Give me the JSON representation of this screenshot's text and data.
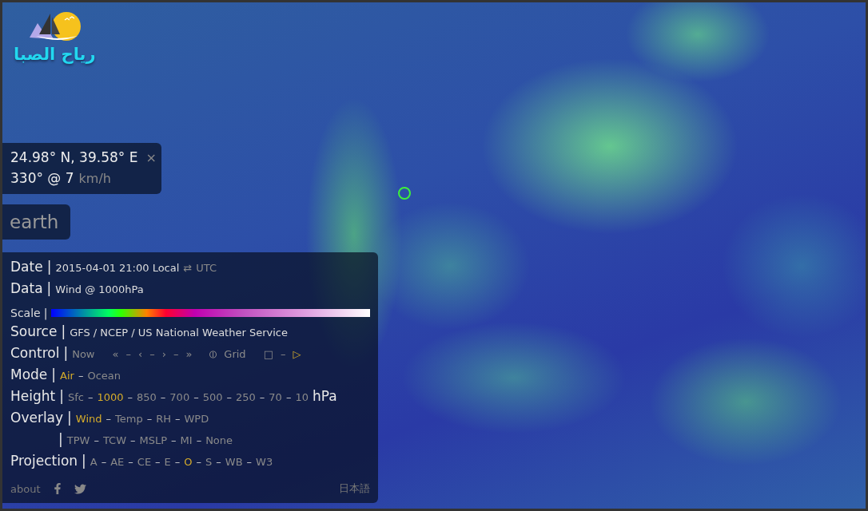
{
  "logo": {
    "text": "رياح الصبا"
  },
  "location": {
    "coords": "24.98° N, 39.58° E",
    "close": "×",
    "wind": "330° @ 7",
    "unit": "km/h"
  },
  "brand": "earth",
  "menu": {
    "date": {
      "label": "Date",
      "divider": "|",
      "value": "2015-04-01 21:00 Local",
      "toggle": "⇄",
      "alt": "UTC"
    },
    "data": {
      "label": "Data",
      "divider": "|",
      "value": "Wind @ 1000hPa"
    },
    "scale": {
      "label": "Scale",
      "divider": "|"
    },
    "source": {
      "label": "Source",
      "divider": "|",
      "value": "GFS / NCEP / US National Weather Service"
    },
    "control": {
      "label": "Control",
      "divider": "|",
      "items": [
        {
          "text": "Now",
          "selected": false
        },
        {
          "text": "«",
          "selected": false
        },
        {
          "text": "–",
          "selected": false
        },
        {
          "text": "‹",
          "selected": false
        },
        {
          "text": "–",
          "selected": false
        },
        {
          "text": "›",
          "selected": false
        },
        {
          "text": "–",
          "selected": false
        },
        {
          "text": "»",
          "selected": false
        },
        {
          "text": "⦶",
          "selected": false
        },
        {
          "text": "Grid",
          "selected": false
        },
        {
          "text": "□",
          "selected": false
        },
        {
          "text": "–",
          "selected": false
        },
        {
          "text": "▷",
          "selected": true
        }
      ]
    },
    "rows": [
      {
        "label": "Mode",
        "divider": "|",
        "separator": "–",
        "options": [
          {
            "text": "Air",
            "selected": true
          },
          {
            "text": "Ocean",
            "selected": false
          }
        ]
      },
      {
        "label": "Height",
        "divider": "|",
        "separator": "–",
        "unit": "hPa",
        "options": [
          {
            "text": "Sfc",
            "selected": false
          },
          {
            "text": "1000",
            "selected": true
          },
          {
            "text": "850",
            "selected": false
          },
          {
            "text": "700",
            "selected": false
          },
          {
            "text": "500",
            "selected": false
          },
          {
            "text": "250",
            "selected": false
          },
          {
            "text": "70",
            "selected": false
          },
          {
            "text": "10",
            "selected": false
          }
        ]
      },
      {
        "label": "Overlay",
        "divider": "|",
        "separator": "–",
        "options": [
          {
            "text": "Wind",
            "selected": true
          },
          {
            "text": "Temp",
            "selected": false
          },
          {
            "text": "RH",
            "selected": false
          },
          {
            "text": "WPD",
            "selected": false
          }
        ]
      },
      {
        "divider": "|",
        "separator": "–",
        "options": [
          {
            "text": "TPW",
            "selected": false
          },
          {
            "text": "TCW",
            "selected": false
          },
          {
            "text": "MSLP",
            "selected": false
          },
          {
            "text": "MI",
            "selected": false
          },
          {
            "text": "None",
            "selected": false
          }
        ]
      },
      {
        "label": "Projection",
        "divider": "|",
        "separator": "–",
        "options": [
          {
            "text": "A",
            "selected": false
          },
          {
            "text": "AE",
            "selected": false
          },
          {
            "text": "CE",
            "selected": false
          },
          {
            "text": "E",
            "selected": false
          },
          {
            "text": "O",
            "selected": true
          },
          {
            "text": "S",
            "selected": false
          },
          {
            "text": "WB",
            "selected": false
          },
          {
            "text": "W3",
            "selected": false
          }
        ]
      }
    ],
    "footer": {
      "about": "about",
      "language": "日本語"
    }
  }
}
